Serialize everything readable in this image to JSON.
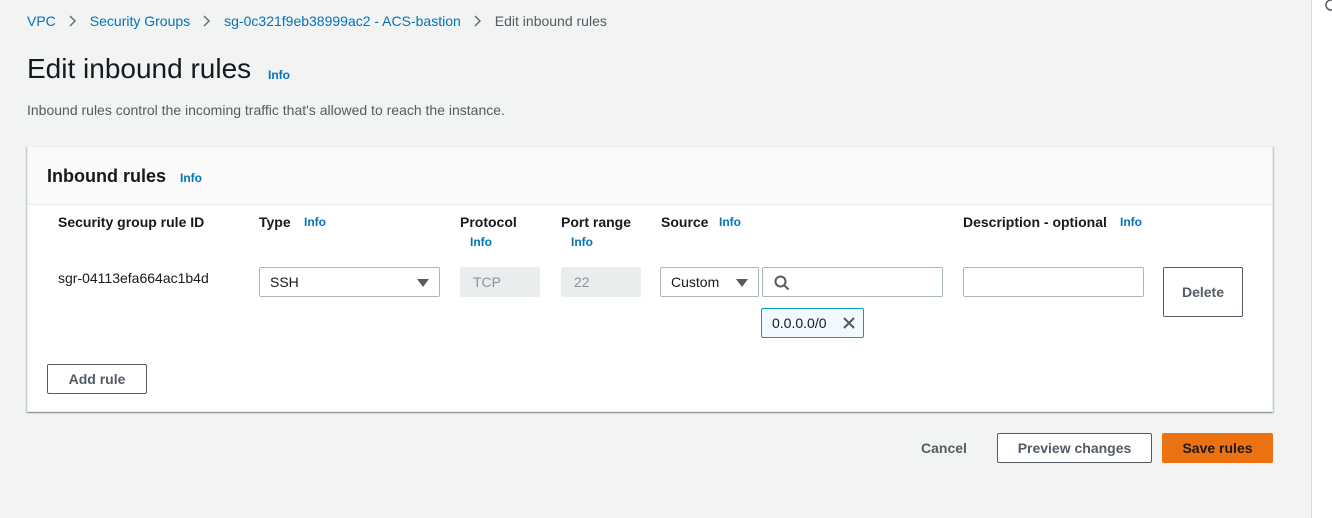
{
  "breadcrumb": {
    "items": [
      "VPC",
      "Security Groups",
      "sg-0c321f9eb38999ac2 - ACS-bastion"
    ],
    "current": "Edit inbound rules"
  },
  "page": {
    "title": "Edit inbound rules",
    "info": "Info",
    "description": "Inbound rules control the incoming traffic that's allowed to reach the instance."
  },
  "panel": {
    "title": "Inbound rules",
    "info": "Info",
    "columns": {
      "rule_id": "Security group rule ID",
      "type": "Type",
      "protocol": "Protocol",
      "port_range": "Port range",
      "source": "Source",
      "description": "Description - optional",
      "info": "Info"
    },
    "rule": {
      "id": "sgr-04113efa664ac1b4d",
      "type": "SSH",
      "protocol": "TCP",
      "port_range": "22",
      "source_mode": "Custom",
      "search_value": "",
      "source_token": "0.0.0.0/0",
      "description_value": "",
      "delete_label": "Delete"
    },
    "add_rule_label": "Add rule"
  },
  "footer": {
    "cancel_label": "Cancel",
    "preview_label": "Preview changes",
    "save_label": "Save rules"
  },
  "colors": {
    "link": "#0073bb",
    "primary_button": "#ec7211",
    "token_border": "#00a1c9"
  },
  "icons": [
    "chevron-right-icon",
    "caret-down-icon",
    "search-icon",
    "close-icon"
  ]
}
